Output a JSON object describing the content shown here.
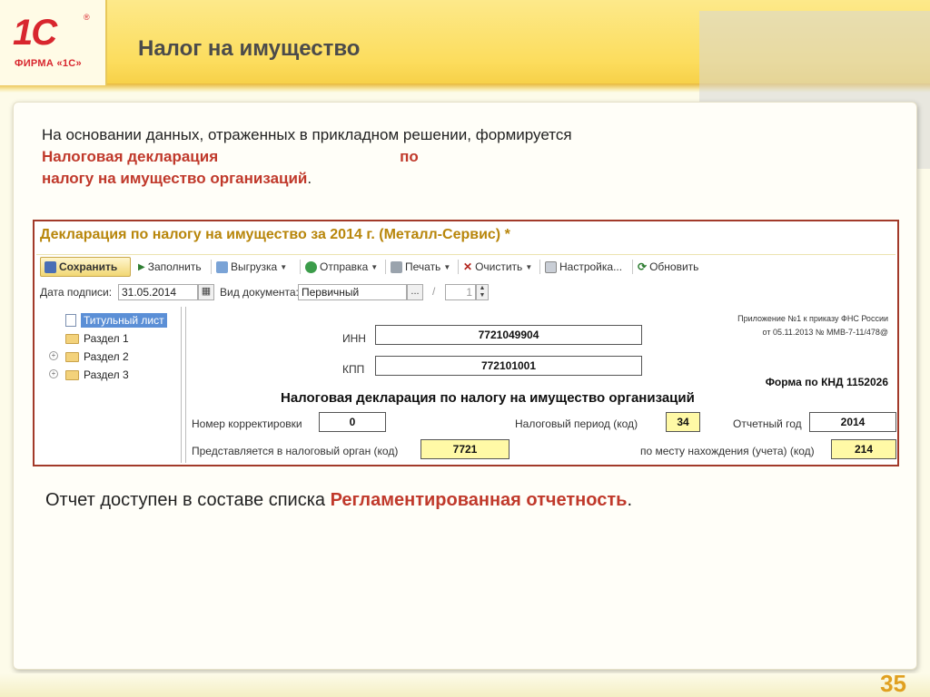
{
  "logo": {
    "mark": "1С",
    "reg": "®",
    "firm": "ФИРМА «1С»"
  },
  "header": {
    "title": "Налог на имущество"
  },
  "intro": {
    "part1": "На основании данных, отраженных в прикладном решении, формируется ",
    "highlight1": "Налоговая декларация",
    "part2": "по",
    "highlight2": "налогу на имущество организаций",
    "part3": "."
  },
  "app": {
    "title": "Декларация по налогу на имущество за 2014 г. (Металл-Сервис) *",
    "toolbar": {
      "save": "Сохранить",
      "fill": "Заполнить",
      "export": "Выгрузка",
      "send": "Отправка",
      "print": "Печать",
      "clear": "Очистить",
      "settings": "Настройка...",
      "refresh": "Обновить"
    },
    "fields": {
      "sign_date_label": "Дата подписи:",
      "sign_date_value": "31.05.2014",
      "doc_type_label": "Вид документа:",
      "doc_type_value": "Первичный",
      "dots": "...",
      "slash": "/",
      "num_value": "1"
    },
    "tree": [
      {
        "label": "Титульный лист"
      },
      {
        "label": "Раздел 1"
      },
      {
        "label": "Раздел 2"
      },
      {
        "label": "Раздел 3"
      }
    ],
    "form": {
      "appendix_line1": "Приложение №1 к приказу ФНС России",
      "appendix_line2": "от 05.11.2013 № ММВ-7-11/478@",
      "inn_label": "ИНН",
      "inn_value": "7721049904",
      "kpp_label": "КПП",
      "kpp_value": "772101001",
      "knd": "Форма по КНД 1152026",
      "decl_title": "Налоговая декларация по налогу на имущество организаций",
      "corr_label": "Номер корректировки",
      "corr_value": "0",
      "period_label": "Налоговый период (код)",
      "period_value": "34",
      "year_label": "Отчетный год",
      "year_value": "2014",
      "authority_label": "Представляется в налоговый орган (код)",
      "authority_value": "7721",
      "location_label": "по месту нахождения (учета) (код)",
      "location_value": "214"
    }
  },
  "footer": {
    "part1": "Отчет доступен в составе списка ",
    "highlight": "Регламентированная отчетность",
    "part2": "."
  },
  "page_number": "35",
  "colors": {
    "accent_red": "#c0392b",
    "brand_red": "#d8262e",
    "header_yellow": "#fcdd5e",
    "page_num": "#e0a020"
  }
}
